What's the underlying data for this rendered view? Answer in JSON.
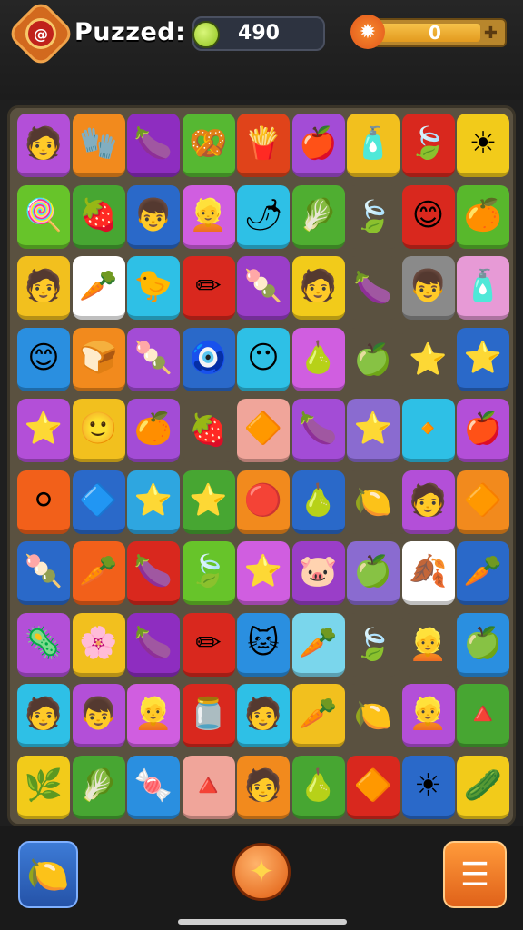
{
  "header": {
    "title": "Puzzed:",
    "score": "490",
    "energy_value": "0",
    "energy_fill_fraction": 0.82
  },
  "icons": {
    "logo": "spiral-logo-icon",
    "coin": "coin-icon",
    "sun": "sun-icon",
    "add": "add-icon",
    "booster_left": "lemon-booster-icon",
    "booster_center": "shuffle-star-icon",
    "menu": "menu-icon"
  },
  "board": {
    "rows": 10,
    "cols": 9,
    "tiles": [
      [
        {
          "c": "#b34fd8",
          "g": "🧑"
        },
        {
          "c": "#f28a1d",
          "g": "🧤"
        },
        {
          "c": "#8e2dc0",
          "g": "🍆"
        },
        {
          "c": "#56b832",
          "g": "🥨"
        },
        {
          "c": "#e0431a",
          "g": "🍟"
        },
        {
          "c": "#a34cd6",
          "g": "🍎"
        },
        {
          "c": "#f2c01e",
          "g": "🧴"
        },
        {
          "c": "#d9281e",
          "g": "🍃"
        },
        {
          "c": "#f2cb1a",
          "g": "☀"
        }
      ],
      [
        {
          "c": "#67c42a",
          "g": "🍭"
        },
        {
          "c": "#47a632",
          "g": "🍓"
        },
        {
          "c": "#2a69c9",
          "g": "👦"
        },
        {
          "c": "#d05ee0",
          "g": "👱"
        },
        {
          "c": "#2ec0e6",
          "g": "🌶"
        },
        {
          "c": "#4fae31",
          "g": "🥬"
        },
        {
          "c": "#5a5140",
          "g": "🍃"
        },
        {
          "c": "#d9281e",
          "g": "😊"
        },
        {
          "c": "#58b82c",
          "g": "🍊"
        }
      ],
      [
        {
          "c": "#f2c01e",
          "g": "🧑"
        },
        {
          "c": "#ffffff",
          "g": "🥕"
        },
        {
          "c": "#2ec0e6",
          "g": "🐤"
        },
        {
          "c": "#d9281e",
          "g": "✏"
        },
        {
          "c": "#9a3ec8",
          "g": "🍡"
        },
        {
          "c": "#f2cb1a",
          "g": "🧑"
        },
        {
          "c": "#5a5140",
          "g": "🍆"
        },
        {
          "c": "#8a8a8a",
          "g": "👦"
        },
        {
          "c": "#e79ad6",
          "g": "🧴"
        }
      ],
      [
        {
          "c": "#2a8fe0",
          "g": "😊"
        },
        {
          "c": "#f28a1d",
          "g": "🍞"
        },
        {
          "c": "#a34cd6",
          "g": "🍡"
        },
        {
          "c": "#2a69c9",
          "g": "🧿"
        },
        {
          "c": "#2ec0e6",
          "g": "😶"
        },
        {
          "c": "#d05ee0",
          "g": "🍐"
        },
        {
          "c": "#5a5140",
          "g": "🍏"
        },
        {
          "c": "#5a5140",
          "g": "⭐"
        },
        {
          "c": "#2a69c9",
          "g": "⭐"
        }
      ],
      [
        {
          "c": "#b34fd8",
          "g": "⭐"
        },
        {
          "c": "#f2c01e",
          "g": "🙂"
        },
        {
          "c": "#a34cd6",
          "g": "🍊"
        },
        {
          "c": "#5a5140",
          "g": "🍓"
        },
        {
          "c": "#f0a59a",
          "g": "🔶"
        },
        {
          "c": "#a34cd6",
          "g": "🍆"
        },
        {
          "c": "#8a6bd0",
          "g": "⭐"
        },
        {
          "c": "#2ec0e6",
          "g": "🔸"
        },
        {
          "c": "#b34fd8",
          "g": "🍎"
        }
      ],
      [
        {
          "c": "#f2601a",
          "g": "⚪"
        },
        {
          "c": "#2a69c9",
          "g": "🔷"
        },
        {
          "c": "#2ea6e0",
          "g": "⭐"
        },
        {
          "c": "#47a632",
          "g": "⭐"
        },
        {
          "c": "#f28a1d",
          "g": "🔴"
        },
        {
          "c": "#2a69c9",
          "g": "🍐"
        },
        {
          "c": "#5a5140",
          "g": "🍋"
        },
        {
          "c": "#b34fd8",
          "g": "🧑"
        },
        {
          "c": "#f28a1d",
          "g": "🔶"
        }
      ],
      [
        {
          "c": "#2a69c9",
          "g": "🍡"
        },
        {
          "c": "#f2601a",
          "g": "🥕"
        },
        {
          "c": "#d9281e",
          "g": "🍆"
        },
        {
          "c": "#67c42a",
          "g": "🍃"
        },
        {
          "c": "#d05ee0",
          "g": "⭐"
        },
        {
          "c": "#9a3ec8",
          "g": "🐷"
        },
        {
          "c": "#8a6bd0",
          "g": "🍏"
        },
        {
          "c": "#ffffff",
          "g": "🍂"
        },
        {
          "c": "#2a69c9",
          "g": "🥕"
        }
      ],
      [
        {
          "c": "#b34fd8",
          "g": "🦠"
        },
        {
          "c": "#f2c01e",
          "g": "🌸"
        },
        {
          "c": "#8e2dc0",
          "g": "🍆"
        },
        {
          "c": "#d9281e",
          "g": "✏"
        },
        {
          "c": "#2a8fe0",
          "g": "🐱"
        },
        {
          "c": "#7ad6ec",
          "g": "🥕"
        },
        {
          "c": "#5a5140",
          "g": "🍃"
        },
        {
          "c": "#5a5140",
          "g": "👱"
        },
        {
          "c": "#2a8fe0",
          "g": "🍏"
        }
      ],
      [
        {
          "c": "#2ec0e6",
          "g": "🧑"
        },
        {
          "c": "#b34fd8",
          "g": "👦"
        },
        {
          "c": "#d05ee0",
          "g": "👱"
        },
        {
          "c": "#d9281e",
          "g": "🫙"
        },
        {
          "c": "#2ec0e6",
          "g": "🧑"
        },
        {
          "c": "#f2c01e",
          "g": "🥕"
        },
        {
          "c": "#5a5140",
          "g": "🍋"
        },
        {
          "c": "#b34fd8",
          "g": "👱"
        },
        {
          "c": "#47a632",
          "g": "🔺"
        }
      ],
      [
        {
          "c": "#f2cb1a",
          "g": "🌿"
        },
        {
          "c": "#47a632",
          "g": "🥬"
        },
        {
          "c": "#2a8fe0",
          "g": "🍬"
        },
        {
          "c": "#f0a59a",
          "g": "🔺"
        },
        {
          "c": "#f28a1d",
          "g": "🧑"
        },
        {
          "c": "#47a632",
          "g": "🍐"
        },
        {
          "c": "#d9281e",
          "g": "🔶"
        },
        {
          "c": "#2a69c9",
          "g": "☀"
        },
        {
          "c": "#f2cb1a",
          "g": "🥒"
        }
      ]
    ]
  }
}
